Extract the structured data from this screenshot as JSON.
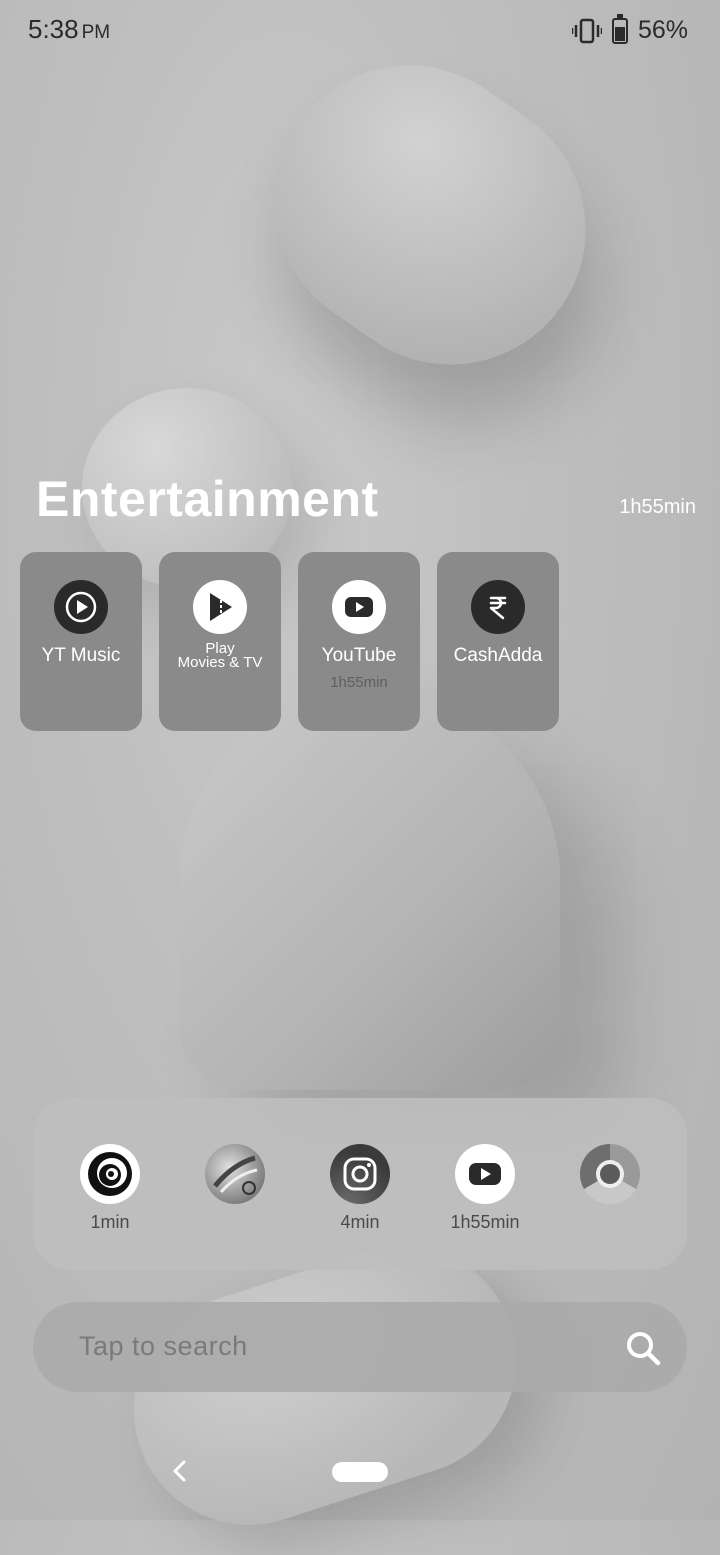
{
  "status_bar": {
    "time": "5:38",
    "ampm": "PM",
    "battery": "56%",
    "icons": [
      "vibrate-icon",
      "battery-icon"
    ]
  },
  "category": {
    "title": "Entertainment",
    "total_time": "1h55min"
  },
  "apps": [
    {
      "name": "YT Music",
      "icon": "yt-music-icon",
      "usage": ""
    },
    {
      "name_line1": "Play",
      "name_line2": "Movies & TV",
      "icon": "play-movies-icon",
      "usage": ""
    },
    {
      "name": "YouTube",
      "icon": "youtube-icon",
      "usage": "1h55min"
    },
    {
      "name": "CashAdda",
      "icon": "rupee-icon",
      "usage": ""
    }
  ],
  "dock": [
    {
      "icon": "vortex-app-icon",
      "usage": "1min"
    },
    {
      "icon": "photo-app-icon",
      "usage": ""
    },
    {
      "icon": "instagram-icon",
      "usage": "4min"
    },
    {
      "icon": "youtube-icon",
      "usage": "1h55min"
    },
    {
      "icon": "chrome-icon",
      "usage": ""
    }
  ],
  "search": {
    "placeholder": "Tap to search"
  },
  "nav": {
    "icons": [
      "back-icon",
      "home-pill"
    ]
  }
}
